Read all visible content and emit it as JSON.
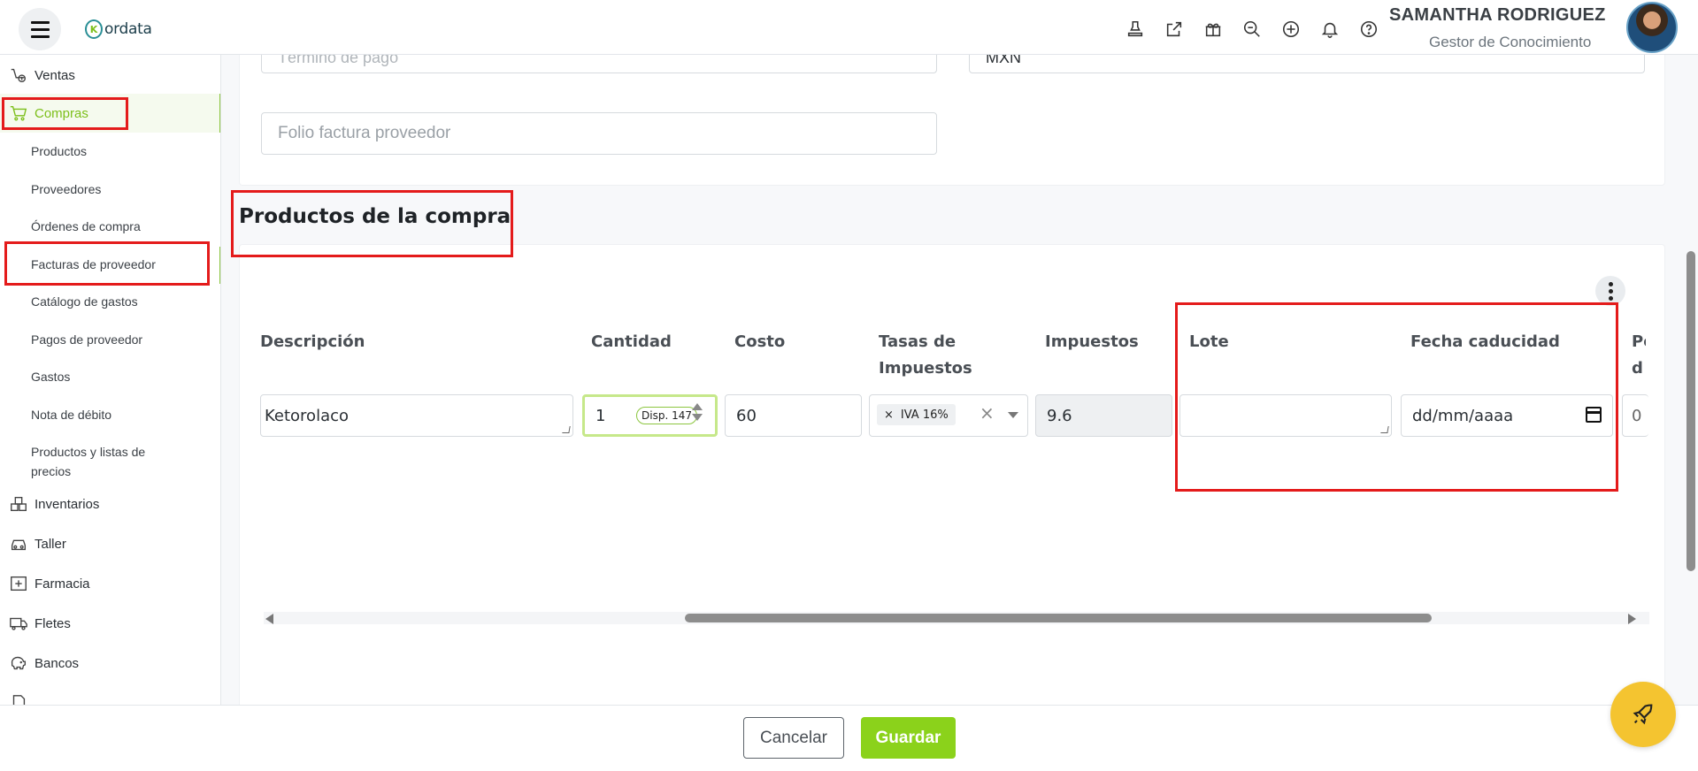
{
  "header": {
    "logo_text": "ordata",
    "logo_mark": "K",
    "user_name": "SAMANTHA RODRIGUEZ",
    "user_role": "Gestor de Conocimiento",
    "icons": [
      "stamp-icon",
      "external-link-icon",
      "gift-icon",
      "search-zoom-icon",
      "plus-circle-icon",
      "bell-icon",
      "help-icon"
    ]
  },
  "sidebar": {
    "ventas": "Ventas",
    "compras": "Compras",
    "sub": [
      "Productos",
      "Proveedores",
      "Órdenes de compra",
      "Facturas de proveedor",
      "Catálogo de gastos",
      "Pagos de proveedor",
      "Gastos",
      "Nota de débito",
      "Productos y listas de precios"
    ],
    "modules": [
      "Inventarios",
      "Taller",
      "Farmacia",
      "Fletes",
      "Bancos"
    ]
  },
  "form": {
    "termino_pago_placeholder": "Término de pago",
    "currency_value": "MXN",
    "folio_placeholder": "Folio factura proveedor"
  },
  "products": {
    "title": "Productos de la compra",
    "columns": {
      "descripcion": "Descripción",
      "cantidad": "Cantidad",
      "costo": "Costo",
      "tasas": "Tasas de Impuestos",
      "impuestos": "Impuestos",
      "lote": "Lote",
      "fecha": "Fecha caducidad",
      "next": "Pe d"
    },
    "row": {
      "descripcion": "Ketorolaco",
      "cantidad": "1",
      "disponible": "Disp. 147",
      "costo": "60",
      "tasa_tag": "IVA 16%",
      "impuestos": "9.6",
      "lote": "",
      "fecha_placeholder": "dd/mm/aaaa",
      "next_value": "0"
    }
  },
  "footer": {
    "cancel": "Cancelar",
    "save": "Guardar"
  },
  "colors": {
    "accent": "#8bd21b",
    "annotation": "#e41b1b"
  }
}
